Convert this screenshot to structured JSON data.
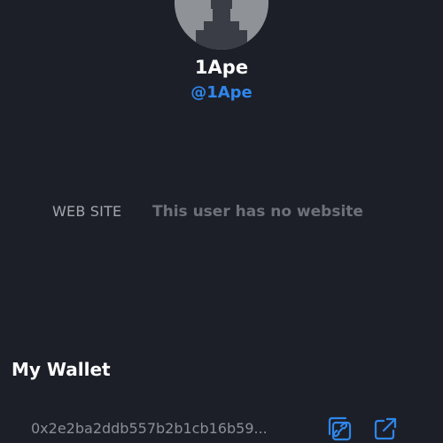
{
  "profile": {
    "display_name": "1Ape",
    "handle": "@1Ape",
    "avatar_icon": "default-avatar-icon"
  },
  "website": {
    "label": "WEB SITE",
    "value": "This user has no website"
  },
  "wallet": {
    "title": "My Wallet",
    "address": "0x2e2ba2ddb557b2b1cb16b59...",
    "copy_icon": "copy-link-icon",
    "open_icon": "external-link-icon"
  },
  "colors": {
    "background": "#1c1f28",
    "accent": "#2f86eb",
    "text_primary": "#ffffff",
    "text_muted": "#6c7079"
  }
}
